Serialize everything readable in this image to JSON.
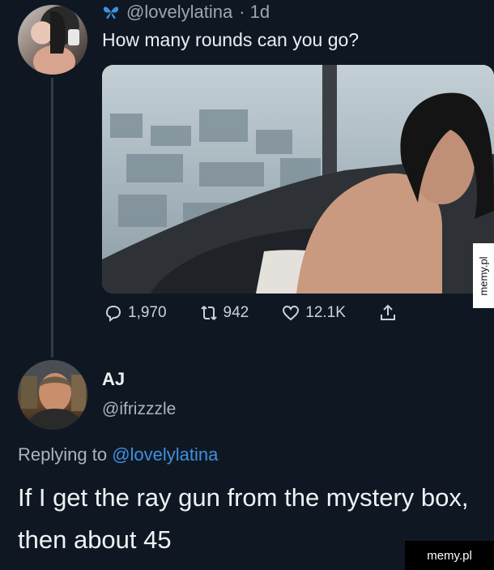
{
  "tweet": {
    "handle": "@lovelylatina",
    "time": "· 1d",
    "text": "How many rounds can you go?",
    "stats": {
      "replies": "1,970",
      "retweets": "942",
      "likes": "12.1K"
    }
  },
  "reply": {
    "name": "AJ",
    "handle": "@ifrizzzle",
    "replying_label": "Replying to",
    "replying_mention": "@lovelylatina",
    "text": "If I get the ray gun from the mystery box, then about 45"
  },
  "watermarks": {
    "side": "memy.pl",
    "bottom": "memy.pl"
  },
  "colors": {
    "background": "#0f1822",
    "mention": "#3f8fe0",
    "muted": "#aab5be"
  },
  "icons": [
    "butterfly-icon",
    "reply-icon",
    "retweet-icon",
    "like-icon",
    "share-icon"
  ]
}
